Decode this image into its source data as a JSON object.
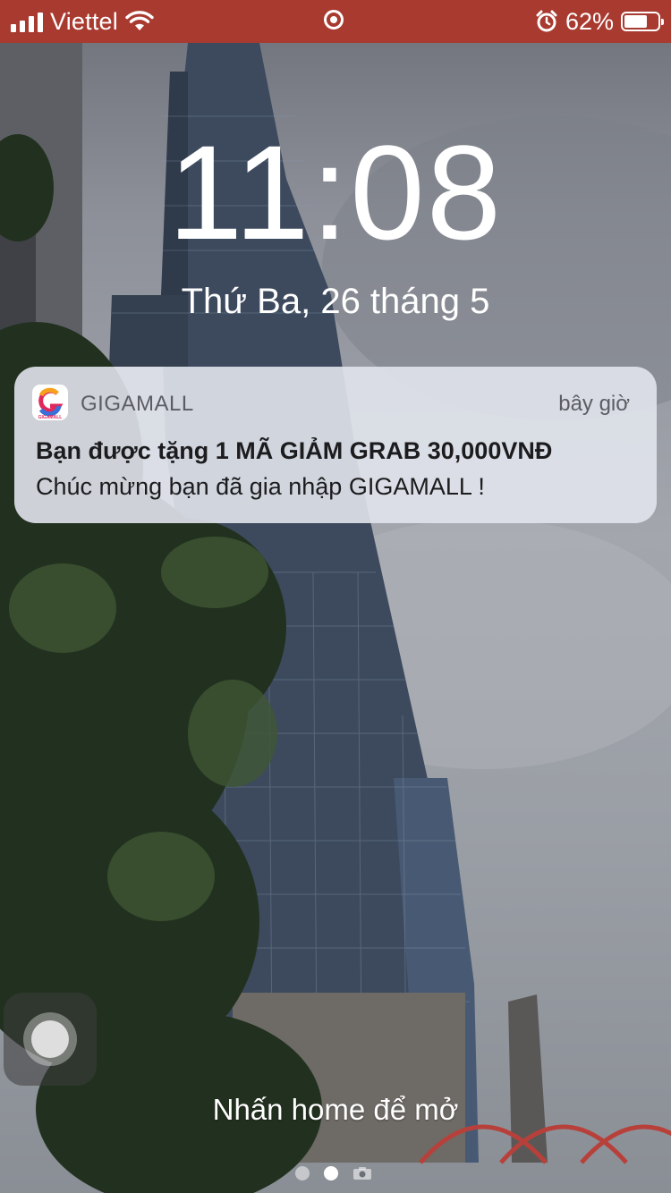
{
  "status_bar": {
    "carrier": "Viettel",
    "battery_percent": "62%",
    "battery_level": 0.62,
    "signal_bars": 4,
    "icons": [
      "signal-icon",
      "wifi-icon",
      "screen-lock-rotation-icon",
      "alarm-icon",
      "battery-icon"
    ],
    "background": "#a83a30"
  },
  "lock_screen": {
    "time": "11:08",
    "date": "Thứ Ba, 26 tháng 5",
    "home_hint": "Nhấn home để mở",
    "pages": {
      "count": 2,
      "active": 2,
      "trailing_icon": "camera-icon"
    }
  },
  "notification": {
    "app_name": "GIGAMALL",
    "app_icon": "gigamall-logo-icon",
    "app_icon_text": "GIGAMALL",
    "time": "bây giờ",
    "title": "Bạn được tặng 1 MÃ GIẢM GRAB 30,000VNĐ",
    "body": "Chúc mừng bạn đã gia nhập GIGAMALL !"
  }
}
